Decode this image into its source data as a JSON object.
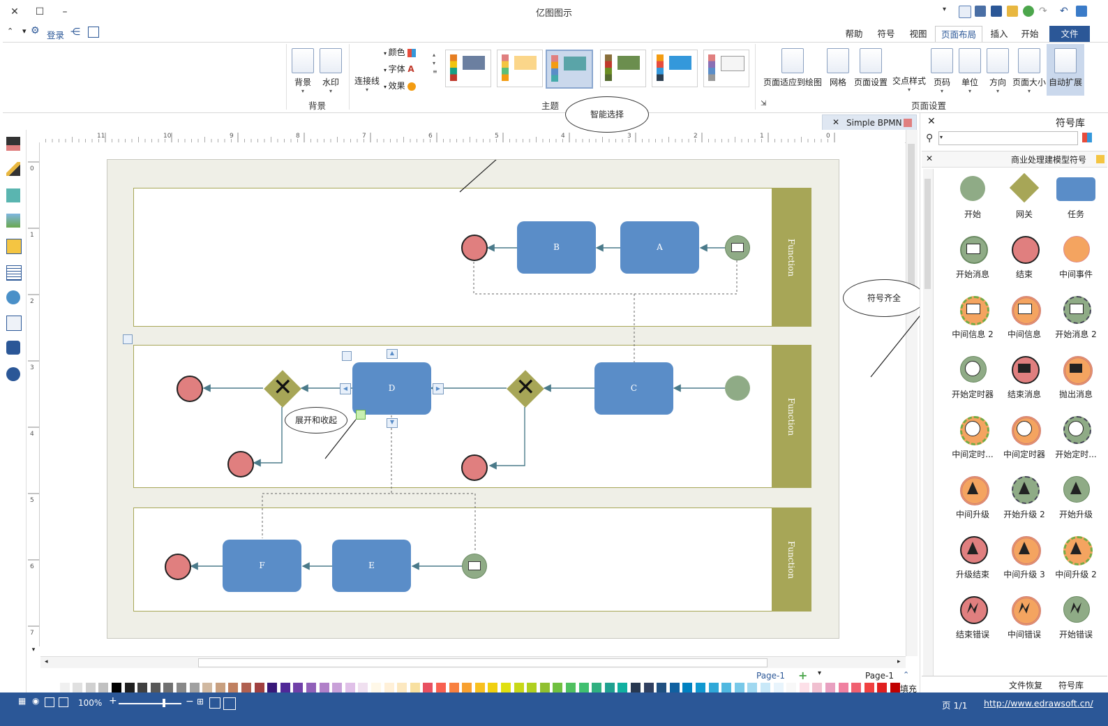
{
  "app": {
    "title": "亿图图示"
  },
  "header": {
    "login": "登录"
  },
  "tabs": [
    {
      "label": "文件"
    },
    {
      "label": "开始"
    },
    {
      "label": "插入"
    },
    {
      "label": "页面布局"
    },
    {
      "label": "视图"
    },
    {
      "label": "符号"
    },
    {
      "label": "帮助"
    }
  ],
  "ribbon": {
    "page_setup": {
      "group_label": "页面设置",
      "buttons": [
        "自动扩展",
        "页面大小",
        "方向",
        "单位",
        "页码",
        "交点样式",
        "页面设置",
        "网格",
        "页面适应到绘图"
      ]
    },
    "theme": {
      "group_label": "主题",
      "color": "颜色",
      "font": "字体",
      "effect": "效果",
      "connector": "连接线"
    },
    "background": {
      "group_label": "背景",
      "buttons": [
        "水印",
        "背景"
      ]
    }
  },
  "document_tab": {
    "label": "Simple BPMN"
  },
  "diagram": {
    "lane_title": "Function",
    "tasks": [
      "A",
      "B",
      "C",
      "D",
      "E",
      "F"
    ]
  },
  "annotations": {
    "smart_select": "智能选择",
    "full_symbols": "符号齐全",
    "expand_collapse": "展开和收起"
  },
  "ruler": {
    "top_ticks": [
      "0",
      "1",
      "2",
      "3",
      "4",
      "5",
      "6",
      "7",
      "8",
      "9",
      "10",
      "11"
    ],
    "left_ticks": [
      "0",
      "1",
      "2",
      "3",
      "4",
      "5",
      "6",
      "7"
    ]
  },
  "library": {
    "title": "符号库",
    "search_placeholder": "",
    "category": "商业处理建模型符号",
    "symbols": [
      {
        "label": "任务",
        "icon": "task-rect"
      },
      {
        "label": "网关",
        "icon": "gateway-diamond"
      },
      {
        "label": "开始",
        "icon": "start-circle"
      },
      {
        "label": "中间事件",
        "icon": "intermediate-circle"
      },
      {
        "label": "结束",
        "icon": "end-circle"
      },
      {
        "label": "开始消息",
        "icon": "start-message"
      },
      {
        "label": "开始消息 2",
        "icon": "start-message-2"
      },
      {
        "label": "中间信息",
        "icon": "intermediate-message"
      },
      {
        "label": "中间信息 2",
        "icon": "intermediate-message-2"
      },
      {
        "label": "抛出消息",
        "icon": "throw-message"
      },
      {
        "label": "结束消息",
        "icon": "end-message"
      },
      {
        "label": "开始定时器",
        "icon": "start-timer"
      },
      {
        "label": "开始定时...",
        "icon": "start-timer-2"
      },
      {
        "label": "中间定时器",
        "icon": "intermediate-timer"
      },
      {
        "label": "中间定时...",
        "icon": "intermediate-timer-2"
      },
      {
        "label": "开始升级",
        "icon": "start-escalation"
      },
      {
        "label": "开始升级 2",
        "icon": "start-escalation-2"
      },
      {
        "label": "中间升级",
        "icon": "intermediate-escalation"
      },
      {
        "label": "中间升级 2",
        "icon": "intermediate-escalation-2"
      },
      {
        "label": "中间升级 3",
        "icon": "intermediate-escalation-3"
      },
      {
        "label": "升级结束",
        "icon": "end-escalation"
      },
      {
        "label": "开始错误",
        "icon": "start-error"
      },
      {
        "label": "中间错误",
        "icon": "intermediate-error"
      },
      {
        "label": "结束错误",
        "icon": "end-error"
      }
    ],
    "bottom_tabs": [
      "符号库",
      "文件恢复"
    ]
  },
  "page_tabs": {
    "current": "Page-1",
    "tab": "Page-1"
  },
  "palette": {
    "fill_label": "填充"
  },
  "status": {
    "url": "http://www.edrawsoft.cn/",
    "page": "页 1/1",
    "zoom": "100%"
  },
  "colors": {
    "accent": "#2b5797",
    "lane": "#a7a657",
    "task": "#5a8dc8",
    "start": "#8fab86",
    "end": "#e07f7f",
    "gateway": "#a7a657",
    "intermediate": "#f4a460"
  }
}
